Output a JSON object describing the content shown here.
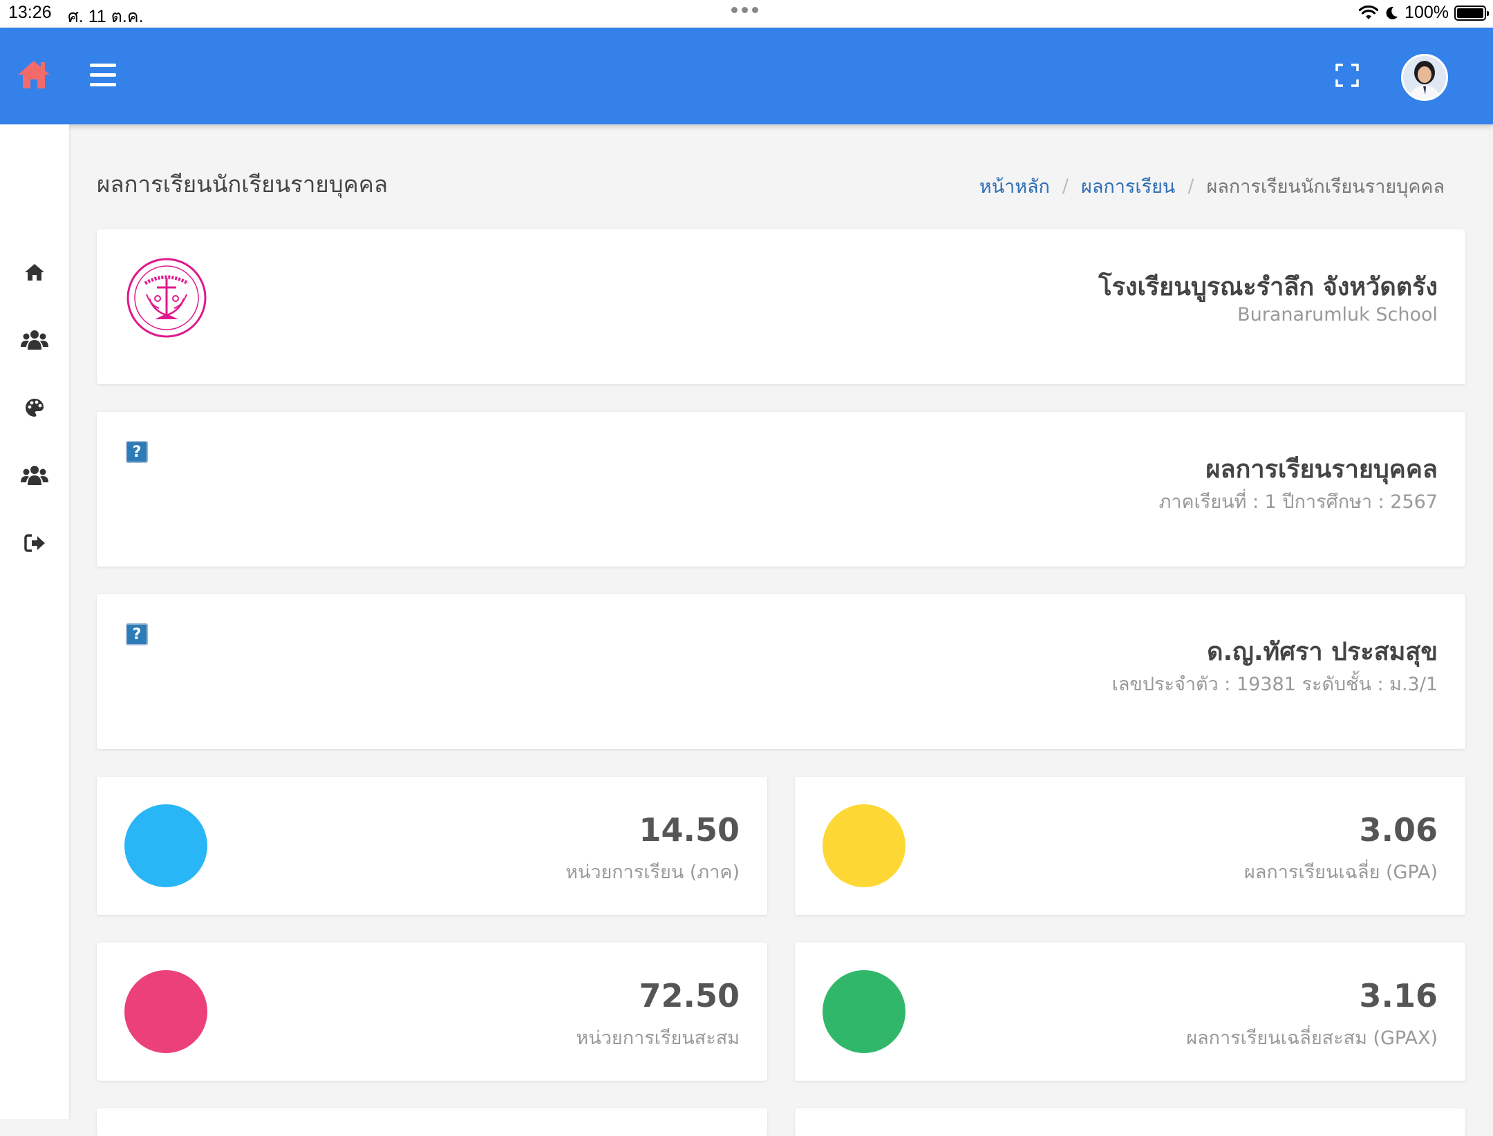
{
  "status_bar": {
    "time": "13:26",
    "date": "ศ. 11 ต.ค.",
    "battery": "100%"
  },
  "navbar": {
    "color": "#3381e9",
    "home_icon_color": "#f26b6b",
    "icons": [
      "home-icon",
      "menu-icon",
      "fullscreen-icon",
      "avatar"
    ]
  },
  "sidebar": {
    "items": [
      {
        "icon": "home-icon"
      },
      {
        "icon": "users-icon"
      },
      {
        "icon": "palette-icon"
      },
      {
        "icon": "users-icon"
      },
      {
        "icon": "sign-out-icon"
      }
    ]
  },
  "page": {
    "title": "ผลการเรียนนักเรียนรายบุคคล",
    "breadcrumb": [
      "หน้าหลัก",
      "ผลการเรียน",
      "ผลการเรียนนักเรียนรายบุคคล"
    ]
  },
  "school": {
    "name_th": "โรงเรียนบูรณะรำลึก จังหวัดตรัง",
    "name_en": "Buranarumluk School"
  },
  "result": {
    "title": "ผลการเรียนรายบุคคล",
    "subtitle": "ภาคเรียนที่ : 1 ปีการศึกษา : 2567"
  },
  "student": {
    "name": "ด.ญ.ทัศรา ประสมสุข",
    "subtitle": "เลขประจำตัว : 19381 ระดับชั้น : ม.3/1"
  },
  "stats": [
    {
      "value": "14.50",
      "label": "หน่วยการเรียน (ภาค)",
      "color": "#29b6f6"
    },
    {
      "value": "3.06",
      "label": "ผลการเรียนเฉลี่ย (GPA)",
      "color": "#fdd835"
    },
    {
      "value": "72.50",
      "label": "หน่วยการเรียนสะสม",
      "color": "#ec407a"
    },
    {
      "value": "3.16",
      "label": "ผลการเรียนเฉลี่ยสะสม (GPAX)",
      "color": "#31b76a"
    }
  ]
}
